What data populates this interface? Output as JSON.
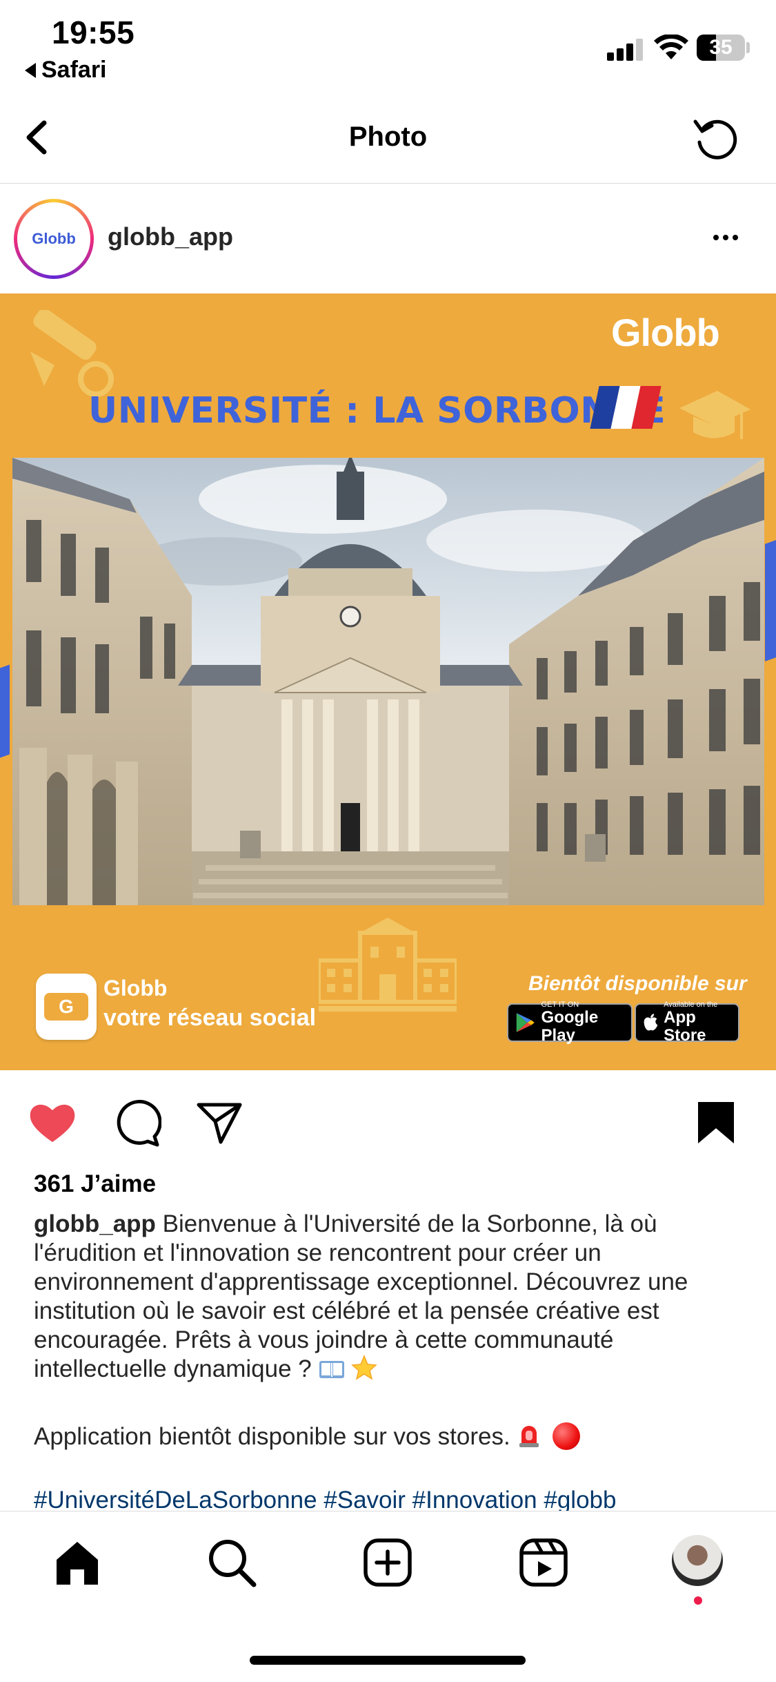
{
  "status_bar": {
    "time": "19:55",
    "back_app": "Safari",
    "battery": "35"
  },
  "nav": {
    "title": "Photo"
  },
  "post": {
    "username": "globb_app",
    "avatar_text": "Globb",
    "image": {
      "brand": "Globb",
      "headline": "UNIVERSITÉ : LA SORBONNE",
      "app_name": "Globb",
      "tagline": "votre réseau social",
      "soon": "Bientôt disponible sur",
      "google_play_small": "GET IT ON",
      "google_play_big": "Google Play",
      "app_store_small": "Available on the",
      "app_store_big": "App Store"
    },
    "likes": "361 J’aime",
    "caption_user": "globb_app",
    "caption_text": "Bienvenue à l'Université de la Sorbonne, là où l'érudition et l'innovation se rencontrent pour créer un environnement d'apprentissage exceptionnel. Découvrez une institution où le savoir est célébré et la pensée créative est encouragée. Prêts à vous joindre à cette communauté intellectuelle dynamique ?",
    "caption_line2": "Application bientôt disponible sur vos stores.",
    "hashtags": "#UniversitéDeLaSorbonne #Savoir #Innovation #globb"
  },
  "colors": {
    "banner_orange": "#eeaa3d",
    "headline_blue": "#3f63d9",
    "like_red": "#ed4956",
    "hashtag_blue": "#00376b"
  },
  "icons": {
    "nav": [
      "back-chevron-icon",
      "refresh-icon"
    ],
    "actions": [
      "heart-icon",
      "comment-icon",
      "share-icon",
      "bookmark-icon"
    ],
    "tabs": [
      "home-icon",
      "search-icon",
      "create-icon",
      "reels-icon",
      "profile-avatar"
    ]
  }
}
